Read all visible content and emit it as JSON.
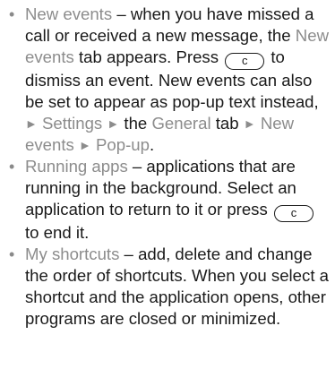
{
  "items": [
    {
      "name": "New events",
      "parts": [
        " – when you have missed a call or received a new message, the ",
        "New events",
        " tab appears. Press ",
        "c",
        " to dismiss an event. New events can also be set to appear as pop-up text instead, ",
        "►",
        "Settings",
        "►",
        " the ",
        "General",
        " tab ",
        "►",
        "New events",
        "►",
        "Pop-up",
        "."
      ]
    },
    {
      "name": "Running apps",
      "parts": [
        " – applications that are running in the background. Select an application to return to it or press ",
        "c",
        " to end it."
      ]
    },
    {
      "name": "My shortcuts",
      "parts": [
        " – add, delete and change the order of shortcuts. When you select a shortcut and the application opens, other programs are closed or minimized."
      ]
    }
  ],
  "bullet_symbol": "•",
  "colors": {
    "text": "#1a1a1a",
    "highlight": "#8c8c8c",
    "bullet": "#8a8a8a"
  }
}
